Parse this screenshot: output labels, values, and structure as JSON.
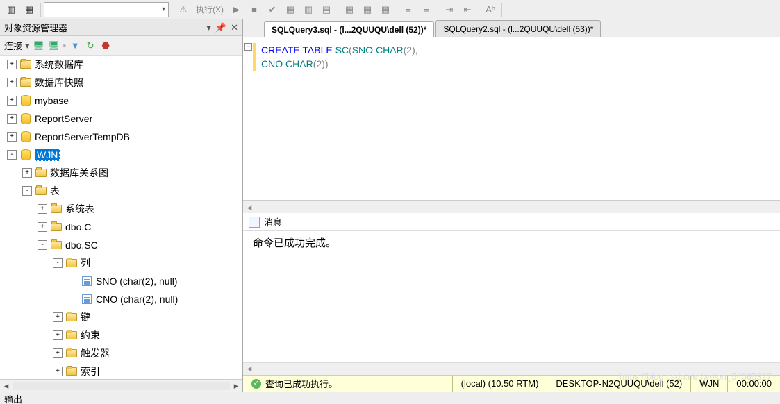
{
  "toolbar": {
    "execute_label": "执行(X)"
  },
  "sidebar": {
    "title": "对象资源管理器",
    "connect_label": "连接",
    "tree": [
      {
        "depth": 0,
        "exp": "+",
        "icon": "folder",
        "label": "系统数据库"
      },
      {
        "depth": 0,
        "exp": "+",
        "icon": "folder",
        "label": "数据库快照"
      },
      {
        "depth": 0,
        "exp": "+",
        "icon": "db",
        "label": "mybase"
      },
      {
        "depth": 0,
        "exp": "+",
        "icon": "db",
        "label": "ReportServer"
      },
      {
        "depth": 0,
        "exp": "+",
        "icon": "db",
        "label": "ReportServerTempDB"
      },
      {
        "depth": 0,
        "exp": "-",
        "icon": "db",
        "label": "WJN",
        "selected": true
      },
      {
        "depth": 1,
        "exp": "+",
        "icon": "folder",
        "label": "数据库关系图"
      },
      {
        "depth": 1,
        "exp": "-",
        "icon": "folder",
        "label": "表"
      },
      {
        "depth": 2,
        "exp": "+",
        "icon": "folder",
        "label": "系统表"
      },
      {
        "depth": 2,
        "exp": "+",
        "icon": "folder",
        "label": "dbo.C"
      },
      {
        "depth": 2,
        "exp": "-",
        "icon": "folder",
        "label": "dbo.SC"
      },
      {
        "depth": 3,
        "exp": "-",
        "icon": "folder",
        "label": "列"
      },
      {
        "depth": 4,
        "exp": "",
        "icon": "col",
        "label": "SNO (char(2), null)"
      },
      {
        "depth": 4,
        "exp": "",
        "icon": "col",
        "label": "CNO (char(2), null)"
      },
      {
        "depth": 3,
        "exp": "+",
        "icon": "folder",
        "label": "键"
      },
      {
        "depth": 3,
        "exp": "+",
        "icon": "folder",
        "label": "约束"
      },
      {
        "depth": 3,
        "exp": "+",
        "icon": "folder",
        "label": "触发器"
      },
      {
        "depth": 3,
        "exp": "+",
        "icon": "folder",
        "label": "索引"
      }
    ]
  },
  "tabs": [
    {
      "label": "SQLQuery3.sql - (l...2QUUQU\\dell (52))*",
      "active": true
    },
    {
      "label": "SQLQuery2.sql - (l...2QUUQU\\dell (53))*",
      "active": false
    }
  ],
  "code": {
    "line1_parts": [
      "CREATE",
      " ",
      "TABLE",
      " ",
      "SC",
      "(",
      "SNO",
      " ",
      "CHAR",
      "(",
      "2",
      "),"
    ],
    "line2_parts": [
      "                ",
      "CNO",
      " ",
      "CHAR",
      "(",
      "2",
      "))"
    ]
  },
  "messages": {
    "header": "消息",
    "body": "命令已成功完成。"
  },
  "status": {
    "success": "查询已成功执行。",
    "server": "(local) (10.50 RTM)",
    "user": "DESKTOP-N2QUUQU\\dell (52)",
    "db": "WJN",
    "time": "00:00:00"
  },
  "footer": "输出",
  "watermark": "https://blog.csdn.net/wolon_54065327"
}
